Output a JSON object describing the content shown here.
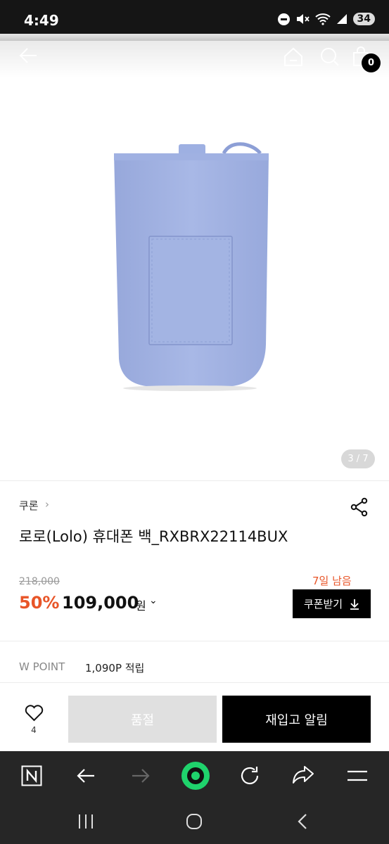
{
  "status_bar": {
    "time": "4:49",
    "battery": "34"
  },
  "header": {
    "cart_count": "0"
  },
  "gallery": {
    "counter": "3 / 7"
  },
  "product": {
    "brand": "쿠론",
    "brand_chevron": "›",
    "title": "로로(Lolo) 휴대폰 백_RXBRX22114BUX",
    "original_price": "218,000",
    "discount": "50%",
    "price": "109,000",
    "price_unit": "원",
    "price_chevron": "⌄",
    "days_left": "7일 남음",
    "coupon_button": "쿠폰받기",
    "point_label": "W POINT",
    "point_value": "1,090P 적립"
  },
  "actions": {
    "like_count": "4",
    "soldout_label": "품절",
    "restock_label": "재입고 알림"
  },
  "colors": {
    "accent": "#e85528",
    "primary": "#000000",
    "product": "#a6b6e4"
  }
}
